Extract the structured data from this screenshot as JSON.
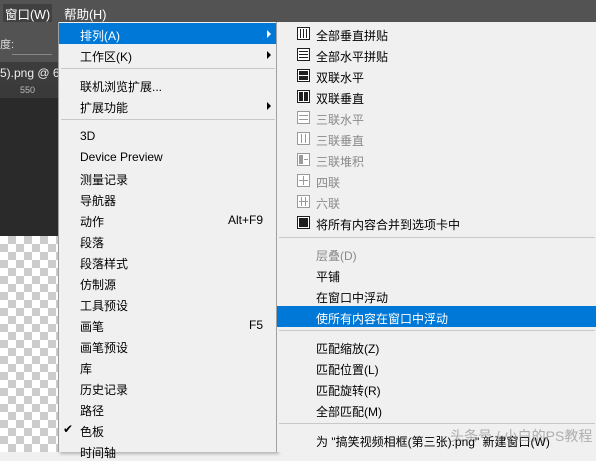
{
  "menubar": {
    "window": "窗口(W)",
    "help": "帮助(H)"
  },
  "background": {
    "options_label": "度:",
    "doc_tab": "5).png @ 6",
    "ruler_tick": "550"
  },
  "window_menu": {
    "arrange": "排列(A)",
    "workspace": "工作区(K)",
    "browse_extensions": "联机浏览扩展...",
    "extensions": "扩展功能",
    "panels": [
      {
        "label": "3D"
      },
      {
        "label": "Device Preview"
      },
      {
        "label": "测量记录"
      },
      {
        "label": "导航器"
      },
      {
        "label": "动作",
        "shortcut": "Alt+F9"
      },
      {
        "label": "段落"
      },
      {
        "label": "段落样式"
      },
      {
        "label": "仿制源"
      },
      {
        "label": "工具预设"
      },
      {
        "label": "画笔",
        "shortcut": "F5"
      },
      {
        "label": "画笔预设"
      },
      {
        "label": "库"
      },
      {
        "label": "历史记录"
      },
      {
        "label": "路径"
      },
      {
        "label": "色板",
        "checked": "✔"
      },
      {
        "label": "时间轴"
      }
    ]
  },
  "arrange_menu": {
    "tile_all_vertical": "全部垂直拼贴",
    "tile_all_horizontal": "全部水平拼贴",
    "two_up_horizontal": "双联水平",
    "two_up_vertical": "双联垂直",
    "three_up_horizontal": "三联水平",
    "three_up_vertical": "三联垂直",
    "three_up_stacked": "三联堆积",
    "four_up": "四联",
    "six_up": "六联",
    "consolidate_tabs": "将所有内容合并到选项卡中",
    "cascade": "层叠(D)",
    "tile": "平铺",
    "float_in_window": "在窗口中浮动",
    "float_all": "使所有内容在窗口中浮动",
    "match_zoom": "匹配缩放(Z)",
    "match_location": "匹配位置(L)",
    "match_rotation": "匹配旋转(R)",
    "match_all": "全部匹配(M)",
    "new_window": "为 \"搞笑视频相框(第三张).png\" 新建窗口(W)"
  },
  "watermark": "头条号 / 小白的PS教程",
  "colors": {
    "highlight": "#0078d7",
    "menu_bg": "#f0f0f0",
    "menubar_bg": "#535353",
    "disabled_text": "#8a8a8a"
  }
}
